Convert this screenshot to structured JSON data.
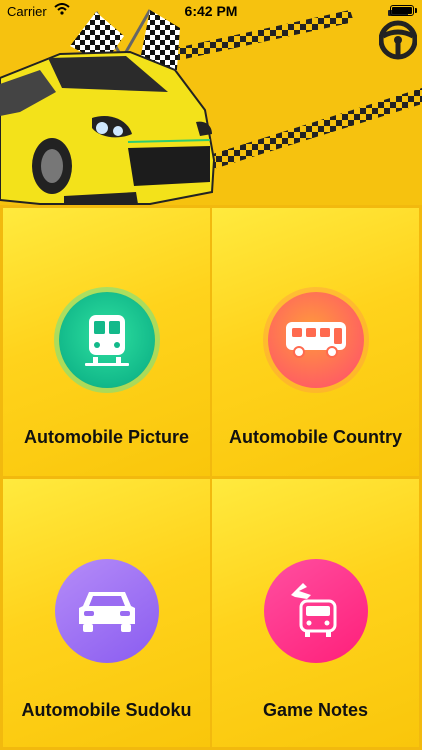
{
  "status_bar": {
    "carrier": "Carrier",
    "time": "6:42 PM"
  },
  "colors": {
    "header_bg": "#f6c20f",
    "tile_bg": "#ffd31c",
    "green": "#12b98a",
    "orange": "#ff5e62",
    "purple": "#8a5cf0",
    "pink": "#ff1f7a"
  },
  "menu": {
    "tiles": [
      {
        "label": "Automobile Picture",
        "icon": "train-front-icon"
      },
      {
        "label": "Automobile Country",
        "icon": "bus-side-icon"
      },
      {
        "label": "Automobile Sudoku",
        "icon": "car-front-icon"
      },
      {
        "label": "Game Notes",
        "icon": "bus-arrival-icon"
      }
    ]
  }
}
